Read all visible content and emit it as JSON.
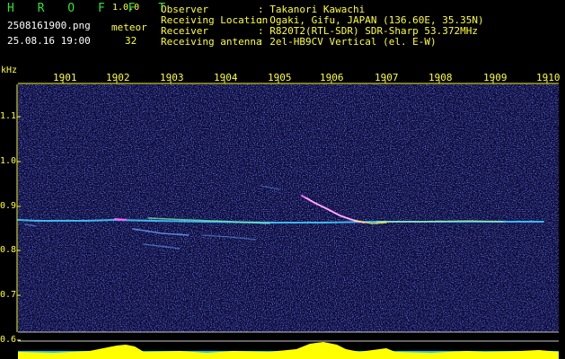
{
  "header": {
    "app_name": "H R O F F T",
    "version": "1.0.0",
    "filename": "2508161900.png",
    "datetime": "25.08.16 19:00",
    "meteor_label": "meteor",
    "meteor_count": "32",
    "fields": [
      {
        "label": "Observer",
        "value": ": Takanori Kawachi"
      },
      {
        "label": "Receiving Location",
        "value": ": Ogaki, Gifu, JAPAN (136.60E, 35.35N)"
      },
      {
        "label": "Receiver",
        "value": ": R820T2(RTL-SDR) SDR-Sharp 53.372MHz"
      },
      {
        "label": "Receiving antenna",
        "value": ": 2el-HB9CV Vertical (el. E-W)"
      }
    ]
  },
  "spectrogram": {
    "y_unit": "kHz",
    "y_ticks": [
      "1.1",
      "1.0",
      "0.9",
      "0.8",
      "0.7",
      "0.6"
    ],
    "x_ticks": [
      "1901",
      "1902",
      "1903",
      "1904",
      "1905",
      "1906",
      "1907",
      "1908",
      "1909",
      "1910"
    ],
    "colors": {
      "background": "#0a0a3c",
      "axis": "#ffff33",
      "carrier": "#40c8ff",
      "meteor": "#ff60ff",
      "level_bar": "#ffff00",
      "level_base": "#00c8ff"
    }
  }
}
